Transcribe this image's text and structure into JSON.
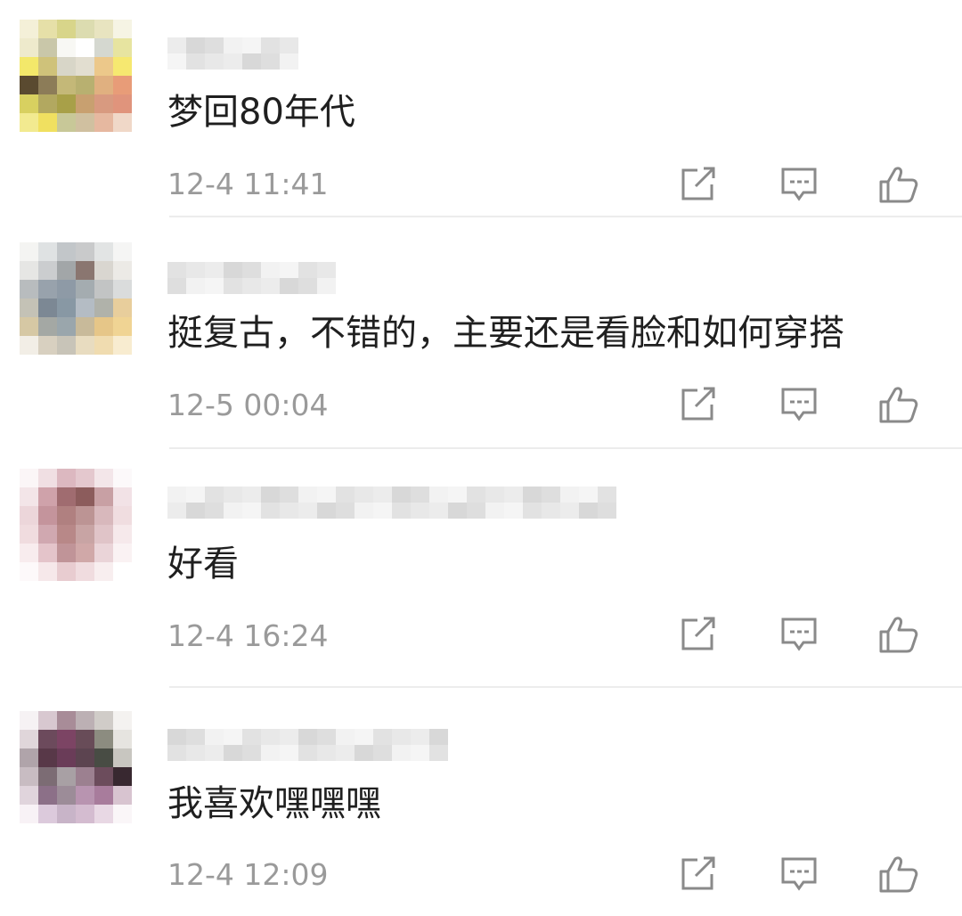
{
  "comments": [
    {
      "text": "梦回80年代",
      "time": "12-4 11:41",
      "avatar_palette": [
        "#f4f0d8",
        "#e6e0a8",
        "#d8d58a",
        "#dcdcb0",
        "#e8e4c0",
        "#f6f4e4",
        "#eeeacc",
        "#c9c7a9",
        "#f8f8f4",
        "#ffffff",
        "#d5d8d0",
        "#e7e4a0",
        "#f3e86a",
        "#cfc27a",
        "#d8d6c8",
        "#e2ded0",
        "#ecc88a",
        "#f6e870",
        "#5a4a30",
        "#8c7c58",
        "#c4b878",
        "#b8b070",
        "#e0b080",
        "#e89c78",
        "#d8d060",
        "#b2a860",
        "#a8a048",
        "#c8a070",
        "#d89a80",
        "#e0947c",
        "#f2ea90",
        "#f0e060",
        "#c8c898",
        "#d0c0a0",
        "#e6b8a0",
        "#f0d8c8"
      ]
    },
    {
      "text": "挺复古，不错的，主要还是看脸和如何穿搭",
      "time": "12-5 00:04",
      "avatar_palette": [
        "#f4f4f2",
        "#dfe2e3",
        "#c2c6c9",
        "#c9cacb",
        "#e2e4e4",
        "#f5f5f4",
        "#e6e6e4",
        "#cbcdcf",
        "#a2a6a8",
        "#8a7670",
        "#d9d6d0",
        "#eceae6",
        "#b8bcbe",
        "#98a2ac",
        "#8e9aa6",
        "#a4acb0",
        "#c2c4c4",
        "#dadcdc",
        "#c4c2b6",
        "#7c8894",
        "#8898a4",
        "#b4bcc4",
        "#b0b2aa",
        "#e8ce9c",
        "#d6c8a4",
        "#a4a8a4",
        "#9aa6ac",
        "#c8ba9a",
        "#e6c688",
        "#f0d494",
        "#f2eee6",
        "#d8d0c0",
        "#c8c4b8",
        "#e8dcc0",
        "#f0dcb0",
        "#f8ecd0"
      ]
    },
    {
      "text": "好看",
      "time": "12-4 16:24",
      "avatar_palette": [
        "#fbf6f7",
        "#f0dfe3",
        "#dcb8c0",
        "#e4c8ce",
        "#f3e6e9",
        "#fcf9fa",
        "#f3e5e8",
        "#cfa2aa",
        "#a06c70",
        "#8c5c5c",
        "#c8a0a4",
        "#f2e2e6",
        "#ecd6da",
        "#c4949c",
        "#b08080",
        "#bc9494",
        "#d8b8bc",
        "#f0dde0",
        "#f0dcdf",
        "#d0a8b0",
        "#b88888",
        "#c8a4a4",
        "#e0c4c8",
        "#f6e9eb",
        "#f8ecee",
        "#e4c4ca",
        "#c09498",
        "#d0a8a8",
        "#ead4d8",
        "#faf2f3",
        "#fdf9fa",
        "#f6e8ea",
        "#e8ccd0",
        "#f0dcdf",
        "#f8eeef",
        "#ffffff"
      ]
    },
    {
      "text": "我喜欢嘿嘿嘿",
      "time": "12-4 12:09",
      "avatar_palette": [
        "#f6f2f4",
        "#d8c8d0",
        "#a88c98",
        "#bcb0b4",
        "#d0ccc8",
        "#f4f2f0",
        "#e0d6da",
        "#6c4a5c",
        "#7c4464",
        "#684c58",
        "#8c8c80",
        "#e6e4e0",
        "#b0a4aa",
        "#583848",
        "#6a3c58",
        "#5c4450",
        "#484c44",
        "#c8c6c0",
        "#c8bcc2",
        "#7c6c74",
        "#a8a0a4",
        "#9c8090",
        "#6c4c5c",
        "#382830",
        "#e0d4dc",
        "#8c7088",
        "#9c8c98",
        "#b894b0",
        "#a87c9c",
        "#d8c4d0",
        "#f8f2f6",
        "#dccadc",
        "#c8b4c8",
        "#d4bcd0",
        "#e8d8e4",
        "#faf6f8"
      ]
    }
  ],
  "icons": {
    "share": "share-icon",
    "reply": "reply-icon",
    "like": "like-icon"
  },
  "colors": {
    "text": "#1f1f1f",
    "meta": "#9a9a9a",
    "icon": "#8a8a8a",
    "divider": "#ececec"
  }
}
